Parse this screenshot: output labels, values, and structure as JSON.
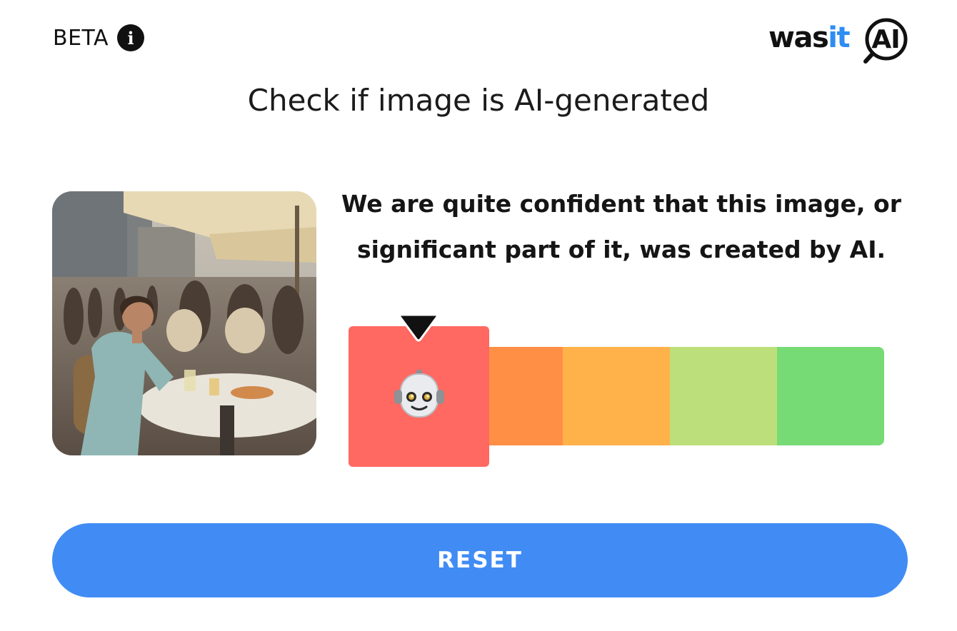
{
  "header": {
    "beta_label": "BETA",
    "info_icon": "info-icon",
    "logo": {
      "part1": "was",
      "part2": "it",
      "part3": "AI"
    }
  },
  "title": "Check if image is AI-generated",
  "image": {
    "alt": "photo-of-outdoor-cafe-scene"
  },
  "result": {
    "verdict_line1": "We are quite confident that this image, or",
    "verdict_line2": "significant part of it, was created by AI.",
    "selected_level_index": 0,
    "selected_icon": "robot-icon",
    "levels": [
      {
        "color": "#ff6961"
      },
      {
        "color": "#ff8f45"
      },
      {
        "color": "#ffb24a"
      },
      {
        "color": "#bcdf7b"
      },
      {
        "color": "#76db74"
      }
    ]
  },
  "actions": {
    "reset_label": "RESET"
  },
  "colors": {
    "accent": "#408cf4",
    "logo_accent": "#2f8df2"
  }
}
